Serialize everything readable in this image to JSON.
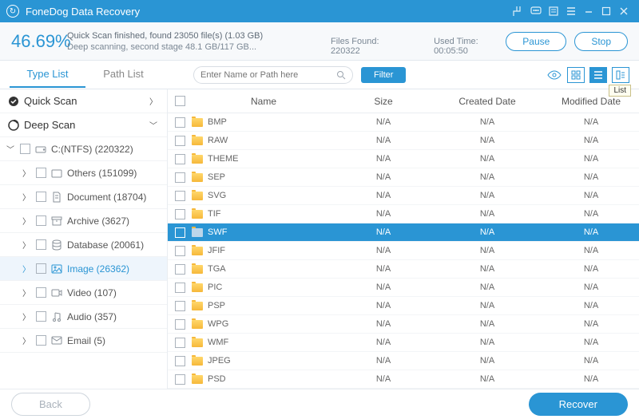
{
  "title": "FoneDog Data Recovery",
  "status": {
    "percent": "46.69%",
    "line1": "Quick Scan finished, found 23050 file(s) (1.03 GB)",
    "line2": "Deep scanning, second stage 48.1 GB/117 GB...",
    "filesFoundLabel": "Files Found:",
    "filesFound": "220322",
    "usedTimeLabel": "Used Time:",
    "usedTime": "00:05:50",
    "pause": "Pause",
    "stop": "Stop"
  },
  "tabs": {
    "type": "Type List",
    "path": "Path List"
  },
  "search": {
    "placeholder": "Enter Name or Path here",
    "filter": "Filter"
  },
  "tooltip": "List",
  "sidebar": {
    "quickScan": "Quick Scan",
    "deepScan": "Deep Scan",
    "drive": "C:(NTFS) (220322)",
    "others": "Others (151099)",
    "document": "Document (18704)",
    "archive": "Archive (3627)",
    "database": "Database (20061)",
    "image": "Image (26362)",
    "video": "Video (107)",
    "audio": "Audio (357)",
    "email": "Email (5)"
  },
  "cols": {
    "name": "Name",
    "size": "Size",
    "created": "Created Date",
    "modified": "Modified Date"
  },
  "rows": [
    {
      "name": "BMP",
      "size": "N/A",
      "created": "N/A",
      "modified": "N/A",
      "sel": false
    },
    {
      "name": "RAW",
      "size": "N/A",
      "created": "N/A",
      "modified": "N/A",
      "sel": false
    },
    {
      "name": "THEME",
      "size": "N/A",
      "created": "N/A",
      "modified": "N/A",
      "sel": false
    },
    {
      "name": "SEP",
      "size": "N/A",
      "created": "N/A",
      "modified": "N/A",
      "sel": false
    },
    {
      "name": "SVG",
      "size": "N/A",
      "created": "N/A",
      "modified": "N/A",
      "sel": false
    },
    {
      "name": "TIF",
      "size": "N/A",
      "created": "N/A",
      "modified": "N/A",
      "sel": false
    },
    {
      "name": "SWF",
      "size": "N/A",
      "created": "N/A",
      "modified": "N/A",
      "sel": true
    },
    {
      "name": "JFIF",
      "size": "N/A",
      "created": "N/A",
      "modified": "N/A",
      "sel": false
    },
    {
      "name": "TGA",
      "size": "N/A",
      "created": "N/A",
      "modified": "N/A",
      "sel": false
    },
    {
      "name": "PIC",
      "size": "N/A",
      "created": "N/A",
      "modified": "N/A",
      "sel": false
    },
    {
      "name": "PSP",
      "size": "N/A",
      "created": "N/A",
      "modified": "N/A",
      "sel": false
    },
    {
      "name": "WPG",
      "size": "N/A",
      "created": "N/A",
      "modified": "N/A",
      "sel": false
    },
    {
      "name": "WMF",
      "size": "N/A",
      "created": "N/A",
      "modified": "N/A",
      "sel": false
    },
    {
      "name": "JPEG",
      "size": "N/A",
      "created": "N/A",
      "modified": "N/A",
      "sel": false
    },
    {
      "name": "PSD",
      "size": "N/A",
      "created": "N/A",
      "modified": "N/A",
      "sel": false
    }
  ],
  "footer": {
    "back": "Back",
    "recover": "Recover"
  }
}
